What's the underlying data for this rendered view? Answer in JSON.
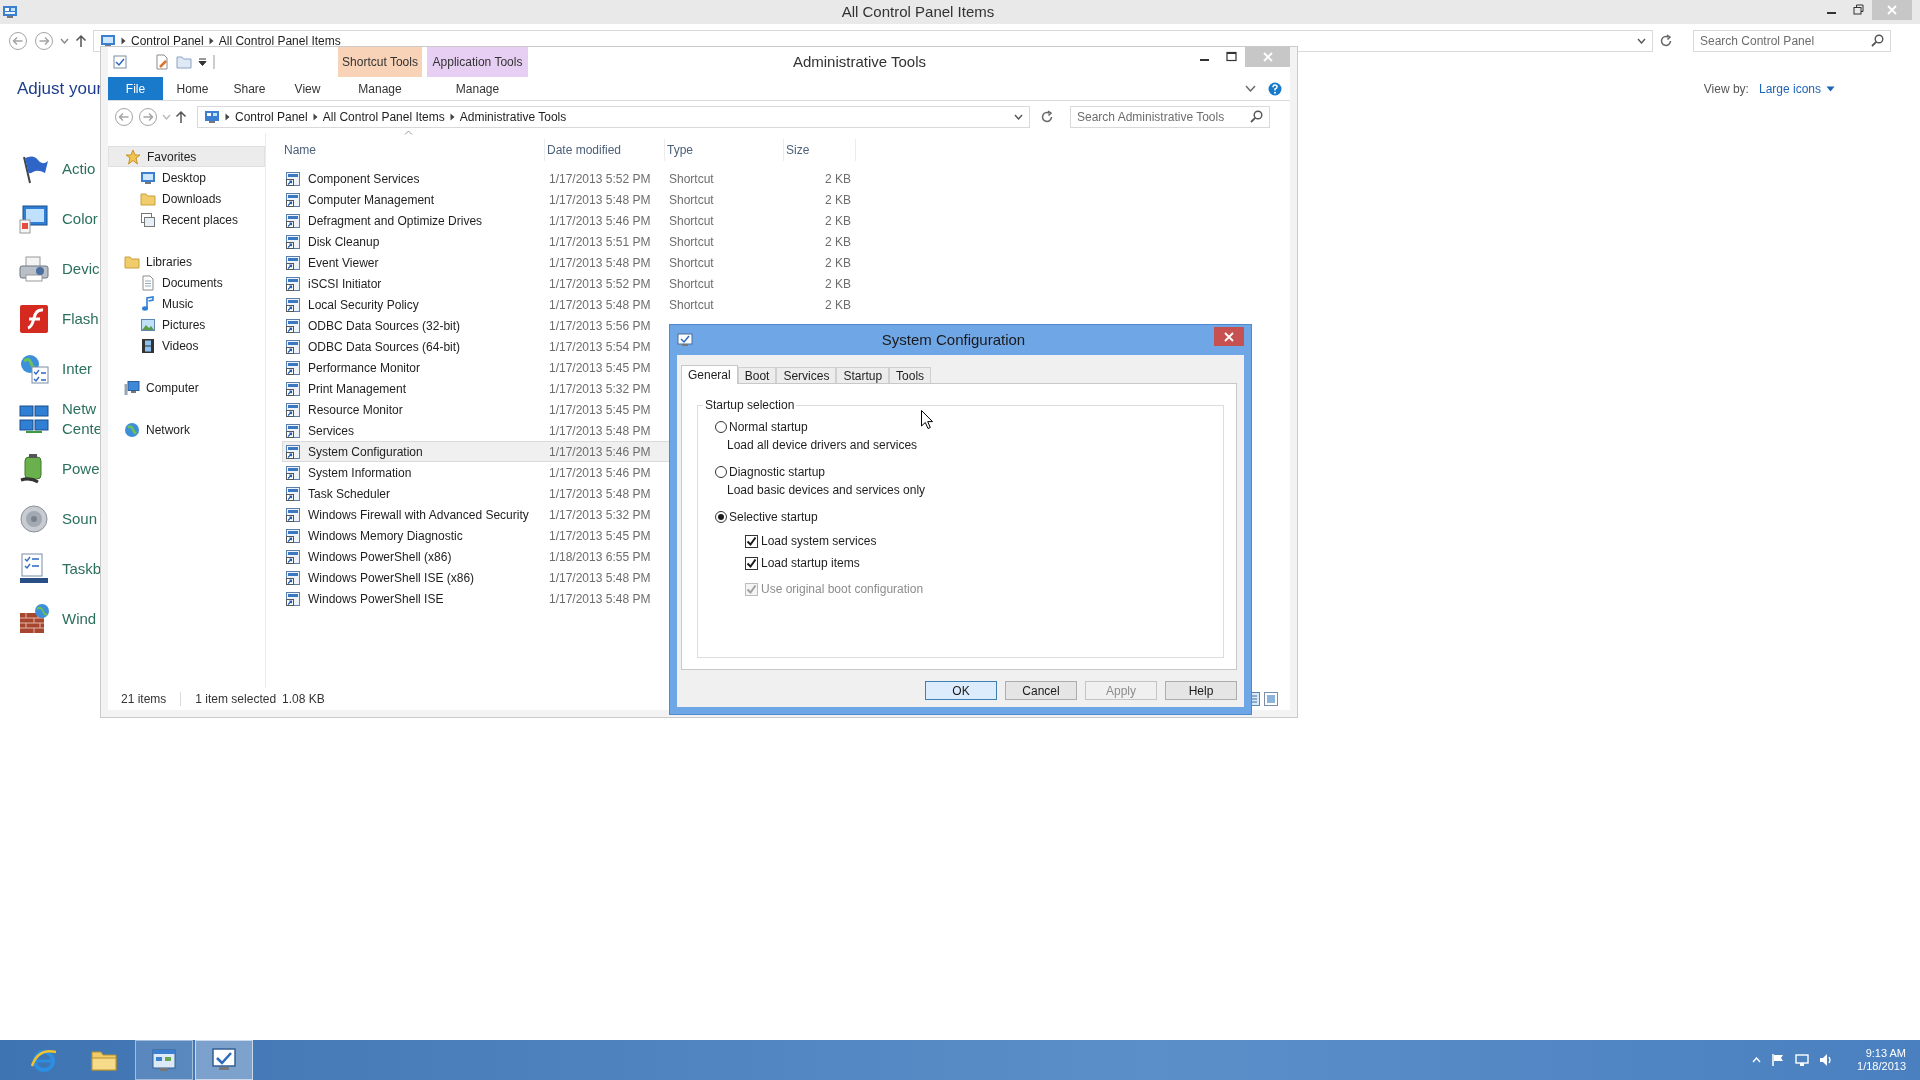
{
  "control_panel": {
    "title": "All Control Panel Items",
    "breadcrumb": [
      "Control Panel",
      "All Control Panel Items"
    ],
    "search": {
      "placeholder": "Search Control Panel"
    },
    "heading": "Adjust your",
    "view_by": {
      "label": "View by:",
      "value": "Large icons"
    },
    "items": [
      {
        "lines": [
          "Actio"
        ]
      },
      {
        "lines": [
          "Color"
        ]
      },
      {
        "lines": [
          "Devic"
        ]
      },
      {
        "lines": [
          "Flash"
        ]
      },
      {
        "lines": [
          "Inter"
        ]
      },
      {
        "lines": [
          "Netw",
          "Cente"
        ]
      },
      {
        "lines": [
          "Powe"
        ]
      },
      {
        "lines": [
          "Soun"
        ]
      },
      {
        "lines": [
          "Taskb"
        ]
      },
      {
        "lines": [
          "Wind"
        ]
      }
    ]
  },
  "explorer": {
    "title": "Administrative Tools",
    "context_tabs": [
      {
        "label": "Shortcut Tools",
        "color": "#f8d3b8"
      },
      {
        "label": "Application Tools",
        "color": "#e7cff3"
      }
    ],
    "ribbon_tabs": [
      {
        "label": "File",
        "kind": "file"
      },
      {
        "label": "Home",
        "kind": "tab"
      },
      {
        "label": "Share",
        "kind": "tab"
      },
      {
        "label": "View",
        "kind": "tab"
      },
      {
        "label": "Manage",
        "kind": "context"
      },
      {
        "label": "Manage",
        "kind": "context"
      }
    ],
    "address": [
      "Control Panel",
      "All Control Panel Items",
      "Administrative Tools"
    ],
    "search": {
      "placeholder": "Search Administrative Tools"
    },
    "navigation": [
      {
        "label": "Favorites",
        "selected": true,
        "children": [
          {
            "label": "Desktop",
            "selected": false
          },
          {
            "label": "Downloads",
            "selected": false
          },
          {
            "label": "Recent places",
            "selected": false
          }
        ]
      },
      {
        "label": "Libraries",
        "selected": false,
        "children": [
          {
            "label": "Documents",
            "selected": false
          },
          {
            "label": "Music",
            "selected": false
          },
          {
            "label": "Pictures",
            "selected": false
          },
          {
            "label": "Videos",
            "selected": false
          }
        ]
      },
      {
        "label": "Computer",
        "selected": false
      },
      {
        "label": "Network",
        "selected": false
      }
    ],
    "columns": [
      "Name",
      "Date modified",
      "Type",
      "Size"
    ],
    "rows": [
      {
        "name": "Component Services",
        "date": "1/17/2013 5:52 PM",
        "type": "Shortcut",
        "size": "2 KB",
        "selected": false
      },
      {
        "name": "Computer Management",
        "date": "1/17/2013 5:48 PM",
        "type": "Shortcut",
        "size": "2 KB",
        "selected": false
      },
      {
        "name": "Defragment and Optimize Drives",
        "date": "1/17/2013 5:46 PM",
        "type": "Shortcut",
        "size": "2 KB",
        "selected": false
      },
      {
        "name": "Disk Cleanup",
        "date": "1/17/2013 5:51 PM",
        "type": "Shortcut",
        "size": "2 KB",
        "selected": false
      },
      {
        "name": "Event Viewer",
        "date": "1/17/2013 5:48 PM",
        "type": "Shortcut",
        "size": "2 KB",
        "selected": false
      },
      {
        "name": "iSCSI Initiator",
        "date": "1/17/2013 5:52 PM",
        "type": "Shortcut",
        "size": "2 KB",
        "selected": false
      },
      {
        "name": "Local Security Policy",
        "date": "1/17/2013 5:48 PM",
        "type": "Shortcut",
        "size": "2 KB",
        "selected": false
      },
      {
        "name": "ODBC Data Sources (32-bit)",
        "date": "1/17/2013 5:56 PM",
        "selected": false
      },
      {
        "name": "ODBC Data Sources (64-bit)",
        "date": "1/17/2013 5:54 PM",
        "selected": false
      },
      {
        "name": "Performance Monitor",
        "date": "1/17/2013 5:45 PM",
        "selected": false
      },
      {
        "name": "Print Management",
        "date": "1/17/2013 5:32 PM",
        "selected": false
      },
      {
        "name": "Resource Monitor",
        "date": "1/17/2013 5:45 PM",
        "selected": false
      },
      {
        "name": "Services",
        "date": "1/17/2013 5:48 PM",
        "selected": false
      },
      {
        "name": "System Configuration",
        "date": "1/17/2013 5:46 PM",
        "selected": true
      },
      {
        "name": "System Information",
        "date": "1/17/2013 5:46 PM",
        "selected": false
      },
      {
        "name": "Task Scheduler",
        "date": "1/17/2013 5:48 PM",
        "selected": false
      },
      {
        "name": "Windows Firewall with Advanced Security",
        "date": "1/17/2013 5:32 PM",
        "selected": false
      },
      {
        "name": "Windows Memory Diagnostic",
        "date": "1/17/2013 5:45 PM",
        "selected": false
      },
      {
        "name": "Windows PowerShell (x86)",
        "date": "1/18/2013 6:55 PM",
        "selected": false
      },
      {
        "name": "Windows PowerShell ISE (x86)",
        "date": "1/17/2013 5:48 PM",
        "selected": false
      },
      {
        "name": "Windows PowerShell ISE",
        "date": "1/17/2013 5:48 PM",
        "selected": false
      }
    ],
    "status": {
      "count": "21 items",
      "selection": "1 item selected",
      "size": "1.08 KB"
    }
  },
  "dialog": {
    "title": "System Configuration",
    "tabs": [
      {
        "label": "General",
        "selected": true
      },
      {
        "label": "Boot",
        "selected": false
      },
      {
        "label": "Services",
        "selected": false
      },
      {
        "label": "Startup",
        "selected": false
      },
      {
        "label": "Tools",
        "selected": false
      }
    ],
    "group_label": "Startup selection",
    "options": [
      {
        "label": "Normal startup",
        "description": "Load all device drivers and services",
        "selected": false
      },
      {
        "label": "Diagnostic startup",
        "description": "Load basic devices and services only",
        "selected": false
      },
      {
        "label": "Selective startup",
        "selected": true,
        "sub_options": [
          {
            "label": "Load system services",
            "checked": true,
            "disabled": false
          },
          {
            "label": "Load startup items",
            "checked": true,
            "disabled": false
          },
          {
            "label": "Use original boot configuration",
            "checked": true,
            "disabled": true
          }
        ]
      }
    ],
    "buttons": [
      {
        "label": "OK",
        "default": true,
        "disabled": false
      },
      {
        "label": "Cancel",
        "default": false,
        "disabled": false
      },
      {
        "label": "Apply",
        "default": false,
        "disabled": true
      },
      {
        "label": "Help",
        "default": false,
        "disabled": false
      }
    ]
  },
  "taskbar": {
    "apps": [
      {
        "running": false,
        "selected": false
      },
      {
        "running": false,
        "selected": false
      },
      {
        "running": true,
        "selected": false
      },
      {
        "running": true,
        "selected": true
      }
    ],
    "clock": {
      "time": "9:13 AM",
      "date": "1/18/2013"
    }
  }
}
